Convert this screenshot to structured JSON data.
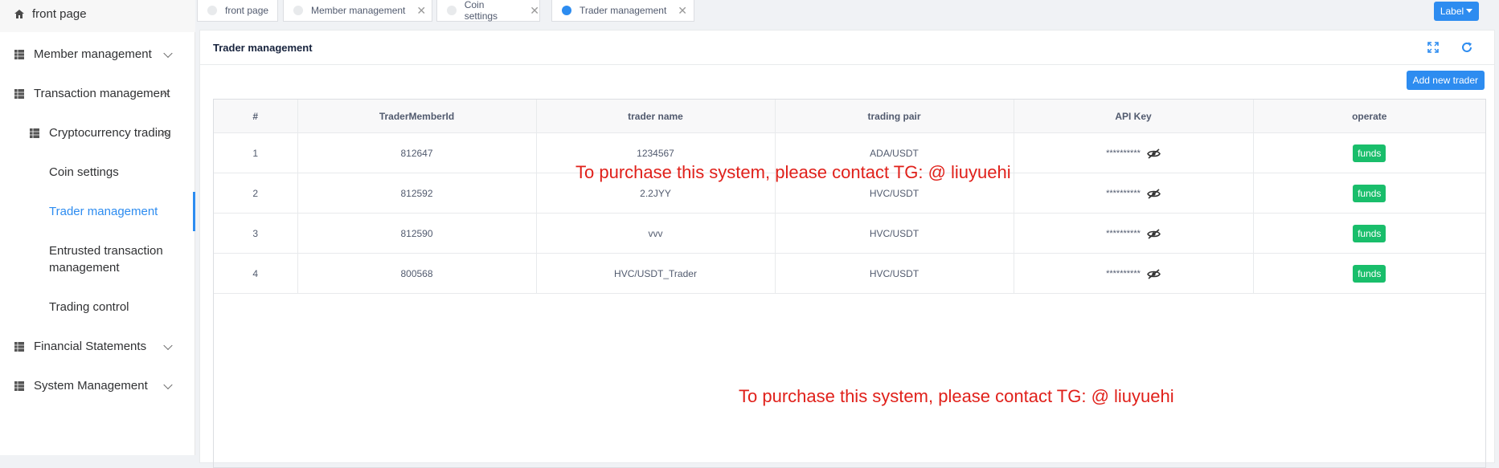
{
  "sidebar": {
    "home": "front page",
    "member": "Member management",
    "transaction": "Transaction management",
    "crypto": "Cryptocurrency trading",
    "coin": "Coin settings",
    "trader": "Trader management",
    "entrusted_1": "Entrusted transaction",
    "entrusted_2": "management",
    "trading_control": "Trading control",
    "financial": "Financial Statements",
    "system": "System Management"
  },
  "tabs": [
    {
      "label": "front page"
    },
    {
      "label": "Member management"
    },
    {
      "label": "Coin settings"
    },
    {
      "label": "Trader management"
    }
  ],
  "label_button": "Label",
  "card": {
    "title": "Trader management",
    "add_button": "Add new trader"
  },
  "table": {
    "headers": [
      "#",
      "TraderMemberId",
      "trader name",
      "trading pair",
      "API Key",
      "operate"
    ],
    "rows": [
      {
        "no": "1",
        "id": "812647",
        "name": "1234567",
        "pair": "ADA/USDT",
        "key": "**********",
        "op": "funds"
      },
      {
        "no": "2",
        "id": "812592",
        "name": "2.2JYY",
        "pair": "HVC/USDT",
        "key": "**********",
        "op": "funds"
      },
      {
        "no": "3",
        "id": "812590",
        "name": "vvv",
        "pair": "HVC/USDT",
        "key": "**********",
        "op": "funds"
      },
      {
        "no": "4",
        "id": "800568",
        "name": "HVC/USDT_Trader",
        "pair": "HVC/USDT",
        "key": "**********",
        "op": "funds"
      }
    ]
  },
  "watermark": "To purchase this system, please contact TG: @ liuyuehi",
  "colors": {
    "primary": "#2d8cf0",
    "success": "#19be6b",
    "watermark": "#e0201a"
  }
}
